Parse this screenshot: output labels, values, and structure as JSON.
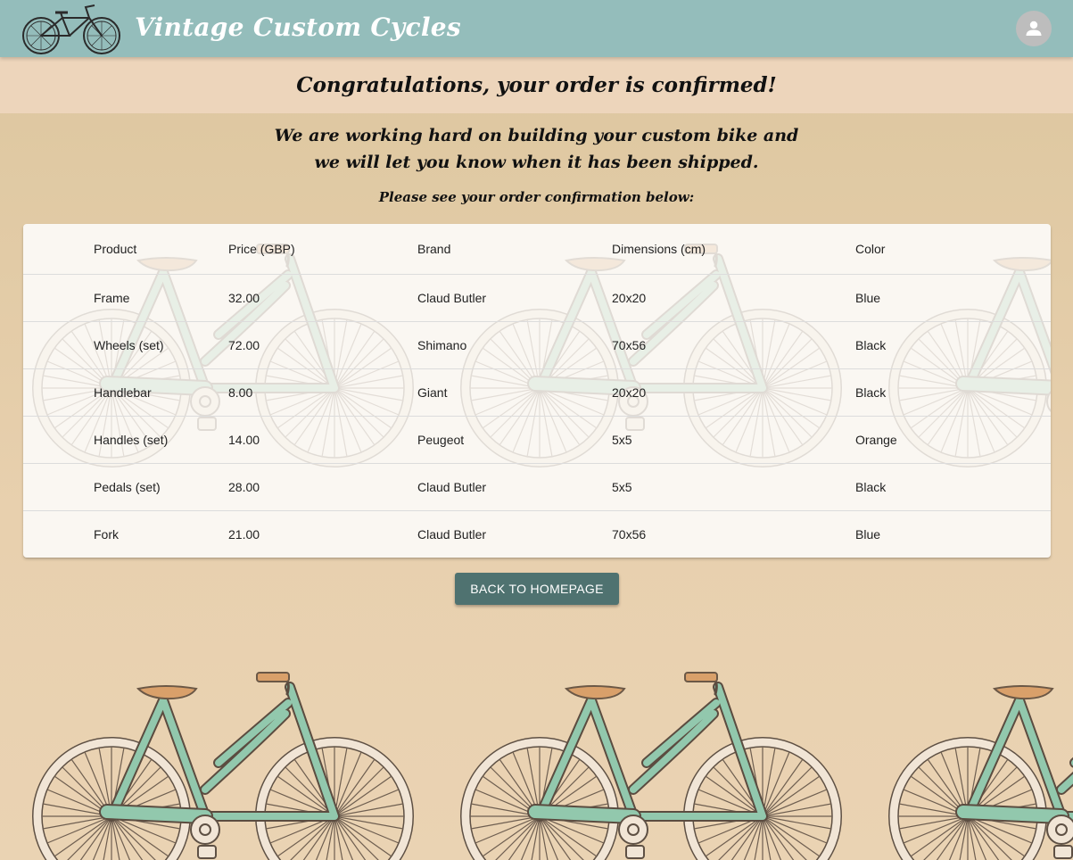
{
  "app": {
    "title": "Vintage Custom Cycles",
    "logo_icon": "vintage-bicycle-logo",
    "account_icon": "account-icon"
  },
  "confirmation": {
    "headline": "Congratulations, your order is confirmed!",
    "message_line1": "We are working hard on building your custom bike and",
    "message_line2": "we will let you know when it has been shipped.",
    "instruction": "Please see your order confirmation below:"
  },
  "order_table": {
    "headers": [
      "Product",
      "Price (GBP)",
      "Brand",
      "Dimensions (cm)",
      "Color"
    ],
    "rows": [
      [
        "Frame",
        "32.00",
        "Claud Butler",
        "20x20",
        "Blue"
      ],
      [
        "Wheels (set)",
        "72.00",
        "Shimano",
        "70x56",
        "Black"
      ],
      [
        "Handlebar",
        "8.00",
        "Giant",
        "20x20",
        "Black"
      ],
      [
        "Handles (set)",
        "14.00",
        "Peugeot",
        "5x5",
        "Orange"
      ],
      [
        "Pedals (set)",
        "28.00",
        "Claud Butler",
        "5x5",
        "Black"
      ],
      [
        "Fork",
        "21.00",
        "Claud Butler",
        "70x56",
        "Blue"
      ]
    ]
  },
  "actions": {
    "back_label": "BACK TO HOMEPAGE"
  },
  "colors": {
    "appbar": "#94bdbb",
    "banner": "#edd5bb",
    "page": "#e6cfae",
    "button": "#4f7270",
    "bike_frame": "#92c8ad",
    "bike_seat": "#d9a06a"
  }
}
